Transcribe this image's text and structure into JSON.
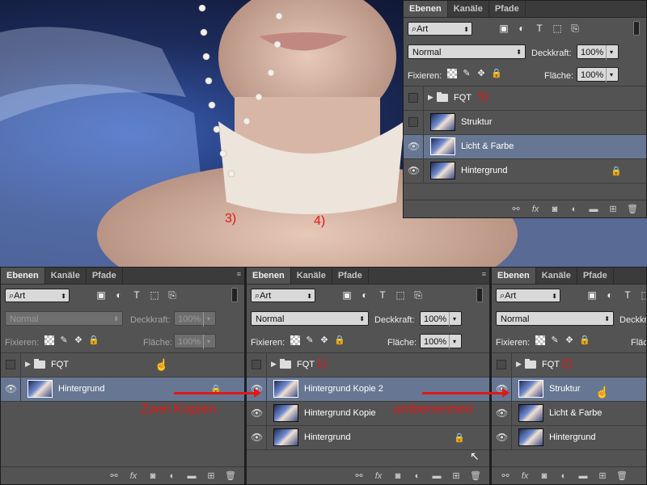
{
  "colors": {
    "panel_bg": "#535353",
    "tab_bar": "#3b3b3b",
    "selected_layer": "#677793",
    "annotation_red": "#e01818"
  },
  "photo": {
    "annotations": [
      "3)",
      "4)"
    ]
  },
  "panels": [
    {
      "id": "top",
      "tabs": [
        "Ebenen",
        "Kanäle",
        "Pfade"
      ],
      "filter": "Art",
      "blend_mode": "Normal",
      "opacity_label": "Deckkraft:",
      "opacity": "100%",
      "lock_label": "Fixieren:",
      "fill_label": "Fläche:",
      "fill": "100%",
      "disabled": false,
      "layers": [
        {
          "type": "group",
          "name": "FQT",
          "visible": false,
          "selected": false,
          "locked": false,
          "annotation": "5)"
        },
        {
          "type": "layer",
          "name": "Struktur",
          "visible": false,
          "selected": false,
          "locked": false,
          "annotation": ""
        },
        {
          "type": "layer",
          "name": "Licht & Farbe",
          "visible": true,
          "selected": true,
          "locked": false,
          "annotation": ""
        },
        {
          "type": "layer",
          "name": "Hintergrund",
          "visible": true,
          "selected": false,
          "locked": true,
          "annotation": ""
        }
      ]
    },
    {
      "id": "bottom-left",
      "tabs": [
        "Ebenen",
        "Kanäle",
        "Pfade"
      ],
      "filter": "Art",
      "blend_mode": "Normal",
      "opacity_label": "Deckkraft:",
      "opacity": "100%",
      "lock_label": "Fixieren:",
      "fill_label": "Fläche:",
      "fill": "100%",
      "disabled": true,
      "layers": [
        {
          "type": "group",
          "name": "FQT",
          "visible": false,
          "selected": false,
          "locked": false,
          "annotation": ""
        },
        {
          "type": "layer",
          "name": "Hintergrund",
          "visible": true,
          "selected": true,
          "locked": true,
          "annotation": ""
        }
      ]
    },
    {
      "id": "bottom-middle",
      "tabs": [
        "Ebenen",
        "Kanäle",
        "Pfade"
      ],
      "filter": "Art",
      "blend_mode": "Normal",
      "opacity_label": "Deckkraft:",
      "opacity": "100%",
      "lock_label": "Fixieren:",
      "fill_label": "Fläche:",
      "fill": "100%",
      "disabled": false,
      "layers": [
        {
          "type": "group",
          "name": "FQT",
          "visible": false,
          "selected": false,
          "locked": false,
          "annotation": "1)"
        },
        {
          "type": "layer",
          "name": "Hintergrund Kopie 2",
          "visible": true,
          "selected": true,
          "locked": false,
          "annotation": ""
        },
        {
          "type": "layer",
          "name": "Hintergrund Kopie",
          "visible": true,
          "selected": false,
          "locked": false,
          "annotation": ""
        },
        {
          "type": "layer",
          "name": "Hintergrund",
          "visible": true,
          "selected": false,
          "locked": true,
          "annotation": ""
        }
      ]
    },
    {
      "id": "bottom-right",
      "tabs": [
        "Ebenen",
        "Kanäle",
        "Pfade"
      ],
      "filter": "Art",
      "blend_mode": "Normal",
      "opacity_label": "Deckkraft:",
      "opacity": "",
      "lock_label": "Fixieren:",
      "fill_label": "Fläc",
      "fill": "",
      "disabled": false,
      "layers": [
        {
          "type": "group",
          "name": "FQT",
          "visible": false,
          "selected": false,
          "locked": false,
          "annotation": "2)"
        },
        {
          "type": "layer",
          "name": "Struktur",
          "visible": true,
          "selected": true,
          "locked": false,
          "annotation": ""
        },
        {
          "type": "layer",
          "name": "Licht & Farbe",
          "visible": true,
          "selected": false,
          "locked": false,
          "annotation": ""
        },
        {
          "type": "layer",
          "name": "Hintergrund",
          "visible": true,
          "selected": false,
          "locked": false,
          "annotation": ""
        }
      ]
    }
  ],
  "overlays": {
    "arrow1_label": "Zwei Kopien",
    "arrow2_label": "umbenennen"
  }
}
